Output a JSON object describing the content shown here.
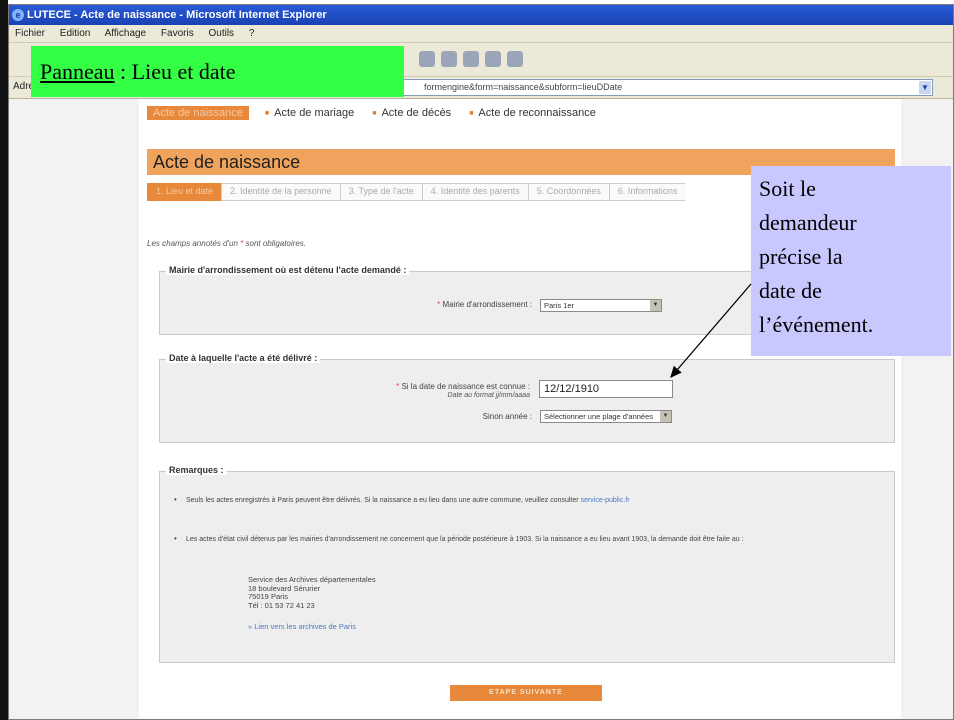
{
  "window": {
    "title": "LUTECE - Acte de naissance - Microsoft Internet Explorer"
  },
  "menubar": {
    "items": [
      "Fichier",
      "Edition",
      "Affichage",
      "Favoris",
      "Outils",
      "?"
    ]
  },
  "addressbar": {
    "label": "Adresse",
    "url": "formengine&form=naissance&subform=lieuDDate"
  },
  "nav": {
    "active": "Acte de naissance",
    "items": [
      "Acte de mariage",
      "Acte de décès",
      "Acte de reconnaissance"
    ]
  },
  "section_title": "Acte de naissance",
  "steps": [
    "1. Lieu et date",
    "2. Identité de la personne",
    "3. Type de l'acte",
    "4. Identité des parents",
    "5. Coordonnées",
    "6. Informations"
  ],
  "required_note": {
    "prefix": "Les champs annotés d'un",
    "star": "*",
    "suffix": "sont obligatoires."
  },
  "mairie": {
    "legend": "Mairie d'arrondissement où est détenu l'acte demandé :",
    "label": "Mairie d'arrondissement :",
    "value": "Paris 1er"
  },
  "date": {
    "legend": "Date à laquelle l'acte a été délivré :",
    "birth_label": "Si la date de naissance est connue :",
    "format_hint": "Date au format jj/mm/aaaa",
    "birth_value": "12/12/1910",
    "year_label": "Sinon année :",
    "year_value": "Sélectionner une plage d'années"
  },
  "remarks": {
    "legend": "Remarques :",
    "item1_text": "Seuls les actes enregistrés à Paris peuvent être délivrés. Si la naissance a eu lieu dans une autre commune, veuillez consulter",
    "item1_link": "service-public.fr",
    "item2_text": "Les actes d'état civil détenus par les mairies d'arrondissement ne concernent que la période postérieure à 1903. Si la naissance a eu lieu avant 1903, la demande doit être faite au :",
    "address_line1": "Service des Archives départementales",
    "address_line2": "18 boulevard Sérurier",
    "address_line3": "75019 Paris",
    "address_line4": "Tél : 01 53 72 41 23",
    "archives_link": "» Lien vers les archives de Paris"
  },
  "next_button": "ETAPE SUIVANTE",
  "callouts": {
    "panel_underlined": "Panneau",
    "panel_rest": " : Lieu et date",
    "note": "Soit le\ndemandeur\nprécise la\ndate de\nl’événement."
  },
  "colors": {
    "accent_orange": "#e8883a",
    "title_bar_orange": "#f0a35c",
    "callout_green": "#33ff44",
    "callout_lavender": "#c8c8ff"
  }
}
